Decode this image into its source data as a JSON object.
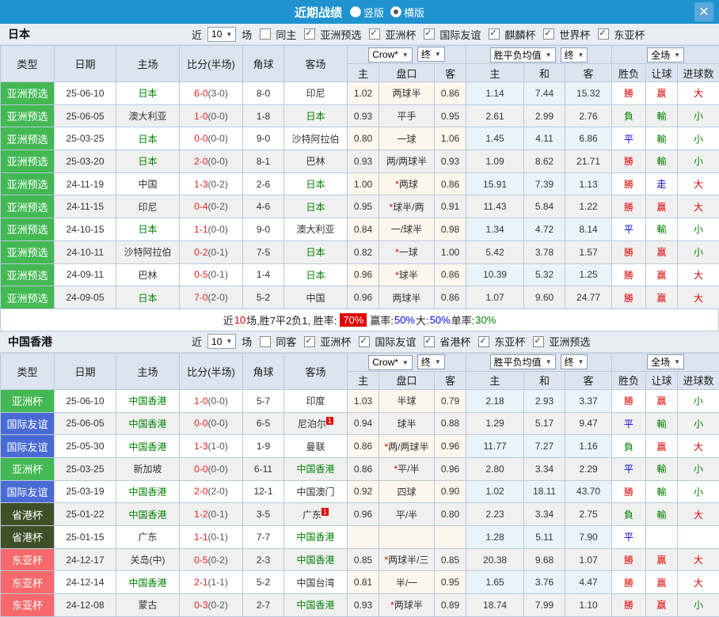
{
  "titlebar": {
    "title": "近期战绩",
    "radio_vertical": "竖版",
    "radio_horizontal": "横版",
    "close": "✕"
  },
  "colors": {
    "type_badges": {
      "亚洲预选": "#43b854",
      "亚洲杯": "#43b854",
      "国际友谊": "#4a6bd4",
      "省港杯": "#3f4f28",
      "东亚杯": "#f7696b"
    },
    "results": {
      "勝": "#dd0000",
      "負": "#008000",
      "平": "#0000dd",
      "赢": "#dd0000",
      "輸": "#008000",
      "走": "#0000dd",
      "大": "#dd0000",
      "小": "#008000"
    }
  },
  "table_header": {
    "main_cols": [
      "类型",
      "日期",
      "主场",
      "比分(半场)",
      "角球",
      "客场"
    ],
    "odds_selects": [
      "Crow*",
      "终"
    ],
    "avg_selects": [
      "胜平负均值",
      "终"
    ],
    "scope_select": "全场",
    "sub_cols": [
      "主",
      "盘口",
      "客",
      "主",
      "和",
      "客",
      "胜负",
      "让球",
      "进球数"
    ]
  },
  "sections": [
    {
      "team": "日本",
      "filter": {
        "prefix": "近",
        "count": "10",
        "suffix": "场",
        "same_label": "同主",
        "same_checked": false,
        "competitions": [
          {
            "label": "亚洲预选",
            "checked": true
          },
          {
            "label": "亚洲杯",
            "checked": true
          },
          {
            "label": "国际友谊",
            "checked": true
          },
          {
            "label": "麒麟杯",
            "checked": true
          },
          {
            "label": "世界杯",
            "checked": true
          },
          {
            "label": "东亚杯",
            "checked": true
          }
        ]
      },
      "rows": [
        {
          "type": "亚洲预选",
          "date": "25-06-10",
          "home": "日本",
          "hg": true,
          "score": "6-0",
          "half": "(3-0)",
          "corners": "8-0",
          "away": "印尼",
          "ag": false,
          "asup": "",
          "o1": "1.02",
          "star": false,
          "line": "两球半",
          "o2": "0.86",
          "avg_h": "1.14",
          "avg_d": "7.44",
          "avg_a": "15.32",
          "r1": "勝",
          "r2": "赢",
          "r3": "大"
        },
        {
          "type": "亚洲预选",
          "date": "25-06-05",
          "home": "澳大利亚",
          "hg": false,
          "score": "1-0",
          "half": "(0-0)",
          "corners": "1-8",
          "away": "日本",
          "ag": true,
          "asup": "",
          "o1": "0.93",
          "star": false,
          "line": "平手",
          "o2": "0.95",
          "avg_h": "2.61",
          "avg_d": "2.99",
          "avg_a": "2.76",
          "r1": "負",
          "r2": "輸",
          "r3": "小"
        },
        {
          "type": "亚洲预选",
          "date": "25-03-25",
          "home": "日本",
          "hg": true,
          "score": "0-0",
          "half": "(0-0)",
          "corners": "9-0",
          "away": "沙特阿拉伯",
          "ag": false,
          "asup": "",
          "o1": "0.80",
          "star": false,
          "line": "一球",
          "o2": "1.06",
          "avg_h": "1.45",
          "avg_d": "4.11",
          "avg_a": "6.86",
          "r1": "平",
          "r2": "輸",
          "r3": "小"
        },
        {
          "type": "亚洲预选",
          "date": "25-03-20",
          "home": "日本",
          "hg": true,
          "score": "2-0",
          "half": "(0-0)",
          "corners": "8-1",
          "away": "巴林",
          "ag": false,
          "asup": "",
          "o1": "0.93",
          "star": false,
          "line": "两/两球半",
          "o2": "0.93",
          "avg_h": "1.09",
          "avg_d": "8.62",
          "avg_a": "21.71",
          "r1": "勝",
          "r2": "輸",
          "r3": "小"
        },
        {
          "type": "亚洲预选",
          "date": "24-11-19",
          "home": "中国",
          "hg": false,
          "score": "1-3",
          "half": "(0-2)",
          "corners": "2-6",
          "away": "日本",
          "ag": true,
          "asup": "",
          "o1": "1.00",
          "star": true,
          "line": "两球",
          "o2": "0.86",
          "avg_h": "15.91",
          "avg_d": "7.39",
          "avg_a": "1.13",
          "r1": "勝",
          "r2": "走",
          "r3": "大"
        },
        {
          "type": "亚洲预选",
          "date": "24-11-15",
          "home": "印尼",
          "hg": false,
          "score": "0-4",
          "half": "(0-2)",
          "corners": "4-6",
          "away": "日本",
          "ag": true,
          "asup": "",
          "o1": "0.95",
          "star": true,
          "line": "球半/两",
          "o2": "0.91",
          "avg_h": "11.43",
          "avg_d": "5.84",
          "avg_a": "1.22",
          "r1": "勝",
          "r2": "赢",
          "r3": "大"
        },
        {
          "type": "亚洲预选",
          "date": "24-10-15",
          "home": "日本",
          "hg": true,
          "score": "1-1",
          "half": "(0-0)",
          "corners": "9-0",
          "away": "澳大利亚",
          "ag": false,
          "asup": "",
          "o1": "0.84",
          "star": false,
          "line": "一/球半",
          "o2": "0.98",
          "avg_h": "1.34",
          "avg_d": "4.72",
          "avg_a": "8.14",
          "r1": "平",
          "r2": "輸",
          "r3": "小"
        },
        {
          "type": "亚洲预选",
          "date": "24-10-11",
          "home": "沙特阿拉伯",
          "hg": false,
          "score": "0-2",
          "half": "(0-1)",
          "corners": "7-5",
          "away": "日本",
          "ag": true,
          "asup": "",
          "o1": "0.82",
          "star": true,
          "line": "一球",
          "o2": "1.00",
          "avg_h": "5.42",
          "avg_d": "3.78",
          "avg_a": "1.57",
          "r1": "勝",
          "r2": "赢",
          "r3": "小"
        },
        {
          "type": "亚洲预选",
          "date": "24-09-11",
          "home": "巴林",
          "hg": false,
          "score": "0-5",
          "half": "(0-1)",
          "corners": "1-4",
          "away": "日本",
          "ag": true,
          "asup": "",
          "o1": "0.96",
          "star": true,
          "line": "球半",
          "o2": "0.86",
          "avg_h": "10.39",
          "avg_d": "5.32",
          "avg_a": "1.25",
          "r1": "勝",
          "r2": "赢",
          "r3": "大"
        },
        {
          "type": "亚洲预选",
          "date": "24-09-05",
          "home": "日本",
          "hg": true,
          "score": "7-0",
          "half": "(2-0)",
          "corners": "5-2",
          "away": "中国",
          "ag": false,
          "asup": "",
          "o1": "0.96",
          "star": false,
          "line": "两球半",
          "o2": "0.86",
          "avg_h": "1.07",
          "avg_d": "9.60",
          "avg_a": "24.77",
          "r1": "勝",
          "r2": "赢",
          "r3": "大"
        }
      ],
      "summary": [
        {
          "t": "近"
        },
        {
          "t": "10",
          "c": "red"
        },
        {
          "t": "场,胜7平2负1, 胜率:"
        },
        {
          "t": "70%",
          "c": "badge"
        },
        {
          "t": "赢率:"
        },
        {
          "t": "50%",
          "c": "blue"
        },
        {
          "t": " 大:"
        },
        {
          "t": "50%",
          "c": "blue"
        },
        {
          "t": " 单率:"
        },
        {
          "t": "30%",
          "c": "green"
        }
      ]
    },
    {
      "team": "中国香港",
      "filter": {
        "prefix": "近",
        "count": "10",
        "suffix": "场",
        "same_label": "同客",
        "same_checked": false,
        "competitions": [
          {
            "label": "亚洲杯",
            "checked": true
          },
          {
            "label": "国际友谊",
            "checked": true
          },
          {
            "label": "省港杯",
            "checked": true
          },
          {
            "label": "东亚杯",
            "checked": true
          },
          {
            "label": "亚洲预选",
            "checked": true
          }
        ]
      },
      "rows": [
        {
          "type": "亚洲杯",
          "date": "25-06-10",
          "home": "中国香港",
          "hg": true,
          "score": "1-0",
          "half": "(0-0)",
          "corners": "5-7",
          "away": "印度",
          "ag": false,
          "asup": "",
          "o1": "1.03",
          "star": false,
          "line": "半球",
          "o2": "0.79",
          "avg_h": "2.18",
          "avg_d": "2.93",
          "avg_a": "3.37",
          "r1": "勝",
          "r2": "赢",
          "r3": "小"
        },
        {
          "type": "国际友谊",
          "date": "25-06-05",
          "home": "中国香港",
          "hg": true,
          "score": "0-0",
          "half": "(0-0)",
          "corners": "6-5",
          "away": "尼泊尔",
          "ag": false,
          "asup": "1",
          "o1": "0.94",
          "star": false,
          "line": "球半",
          "o2": "0.88",
          "avg_h": "1.29",
          "avg_d": "5.17",
          "avg_a": "9.47",
          "r1": "平",
          "r2": "輸",
          "r3": "小"
        },
        {
          "type": "国际友谊",
          "date": "25-05-30",
          "home": "中国香港",
          "hg": true,
          "score": "1-3",
          "half": "(1-0)",
          "corners": "1-9",
          "away": "曼联",
          "ag": false,
          "asup": "",
          "o1": "0.86",
          "star": true,
          "line": "两/两球半",
          "o2": "0.96",
          "avg_h": "11.77",
          "avg_d": "7.27",
          "avg_a": "1.16",
          "r1": "負",
          "r2": "赢",
          "r3": "大"
        },
        {
          "type": "亚洲杯",
          "date": "25-03-25",
          "home": "新加坡",
          "hg": false,
          "score": "0-0",
          "half": "(0-0)",
          "corners": "6-11",
          "away": "中国香港",
          "ag": true,
          "asup": "",
          "o1": "0.86",
          "star": true,
          "line": "平/半",
          "o2": "0.96",
          "avg_h": "2.80",
          "avg_d": "3.34",
          "avg_a": "2.29",
          "r1": "平",
          "r2": "輸",
          "r3": "小"
        },
        {
          "type": "国际友谊",
          "date": "25-03-19",
          "home": "中国香港",
          "hg": true,
          "score": "2-0",
          "half": "(2-0)",
          "corners": "12-1",
          "away": "中国澳门",
          "ag": false,
          "asup": "",
          "o1": "0.92",
          "star": false,
          "line": "四球",
          "o2": "0.90",
          "avg_h": "1.02",
          "avg_d": "18.11",
          "avg_a": "43.70",
          "r1": "勝",
          "r2": "輸",
          "r3": "小"
        },
        {
          "type": "省港杯",
          "date": "25-01-22",
          "home": "中国香港",
          "hg": true,
          "score": "1-2",
          "half": "(0-1)",
          "corners": "3-5",
          "away": "广东",
          "ag": false,
          "asup": "1",
          "o1": "0.96",
          "star": false,
          "line": "平/半",
          "o2": "0.80",
          "avg_h": "2.23",
          "avg_d": "3.34",
          "avg_a": "2.75",
          "r1": "負",
          "r2": "輸",
          "r3": "大"
        },
        {
          "type": "省港杯",
          "date": "25-01-15",
          "home": "广东",
          "hg": false,
          "score": "1-1",
          "half": "(0-1)",
          "corners": "7-7",
          "away": "中国香港",
          "ag": true,
          "asup": "",
          "o1": "",
          "star": false,
          "line": "",
          "o2": "",
          "avg_h": "1.28",
          "avg_d": "5.11",
          "avg_a": "7.90",
          "r1": "平",
          "r2": "",
          "r3": ""
        },
        {
          "type": "东亚杯",
          "date": "24-12-17",
          "home": "关岛(中)",
          "hg": false,
          "score": "0-5",
          "half": "(0-2)",
          "corners": "2-3",
          "away": "中国香港",
          "ag": true,
          "asup": "",
          "o1": "0.85",
          "star": true,
          "line": "两球半/三",
          "o2": "0.85",
          "avg_h": "20.38",
          "avg_d": "9.68",
          "avg_a": "1.07",
          "r1": "勝",
          "r2": "赢",
          "r3": "大"
        },
        {
          "type": "东亚杯",
          "date": "24-12-14",
          "home": "中国香港",
          "hg": true,
          "score": "2-1",
          "half": "(1-1)",
          "corners": "5-2",
          "away": "中国台湾",
          "ag": false,
          "asup": "",
          "o1": "0.81",
          "star": false,
          "line": "半/一",
          "o2": "0.95",
          "avg_h": "1.65",
          "avg_d": "3.76",
          "avg_a": "4.47",
          "r1": "勝",
          "r2": "赢",
          "r3": "大"
        },
        {
          "type": "东亚杯",
          "date": "24-12-08",
          "home": "蒙古",
          "hg": false,
          "score": "0-3",
          "half": "(0-2)",
          "corners": "2-7",
          "away": "中国香港",
          "ag": true,
          "asup": "",
          "o1": "0.93",
          "star": true,
          "line": "两球半",
          "o2": "0.89",
          "avg_h": "18.74",
          "avg_d": "7.99",
          "avg_a": "1.10",
          "r1": "勝",
          "r2": "赢",
          "r3": "小"
        }
      ],
      "summary": null
    }
  ]
}
